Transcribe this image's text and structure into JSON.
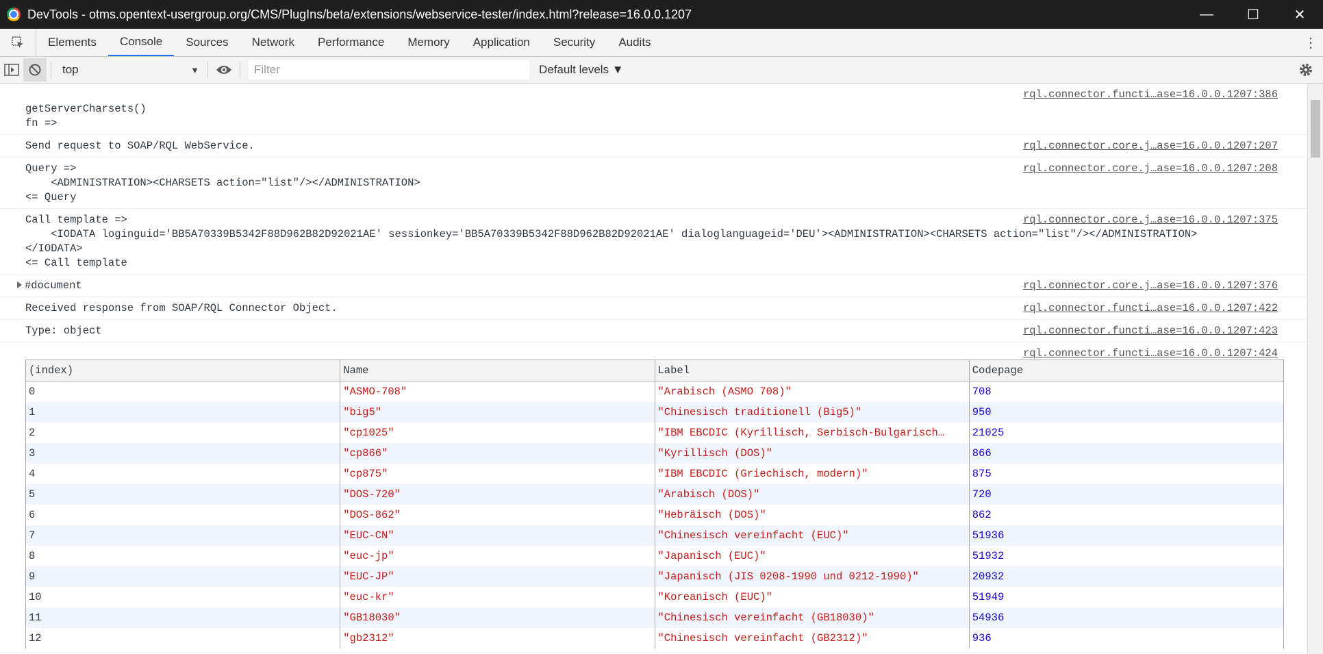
{
  "window": {
    "title": "DevTools - otms.opentext-usergroup.org/CMS/PlugIns/beta/extensions/webservice-tester/index.html?release=16.0.0.1207",
    "minimize": "—",
    "maximize": "☐",
    "close": "✕"
  },
  "tabs": [
    "Elements",
    "Console",
    "Sources",
    "Network",
    "Performance",
    "Memory",
    "Application",
    "Security",
    "Audits"
  ],
  "toolbar": {
    "context": "top",
    "filter_placeholder": "Filter",
    "levels": "Default levels ▼"
  },
  "messages": [
    {
      "text": "\ngetServerCharsets()\nfn =>",
      "source": "rql.connector.functi…ase=16.0.0.1207:386"
    },
    {
      "text": "Send request to SOAP/RQL WebService.",
      "source": "rql.connector.core.j…ase=16.0.0.1207:207"
    },
    {
      "text": "Query =>\n    <ADMINISTRATION><CHARSETS action=\"list\"/></ADMINISTRATION>\n<= Query",
      "source": "rql.connector.core.j…ase=16.0.0.1207:208"
    },
    {
      "text": "Call template =>\n    <IODATA loginguid='BB5A70339B5342F88D962B82D92021AE' sessionkey='BB5A70339B5342F88D962B82D92021AE' dialoglanguageid='DEU'><ADMINISTRATION><CHARSETS action=\"list\"/></ADMINISTRATION>\n</IODATA>\n<= Call template",
      "source": "rql.connector.core.j…ase=16.0.0.1207:375"
    },
    {
      "text": "#document",
      "source": "rql.connector.core.j…ase=16.0.0.1207:376",
      "expandable": true
    },
    {
      "text": "Received response from SOAP/RQL Connector Object.",
      "source": "rql.connector.functi…ase=16.0.0.1207:422"
    },
    {
      "text": "Type: object",
      "source": "rql.connector.functi…ase=16.0.0.1207:423"
    }
  ],
  "table_source": "rql.connector.functi…ase=16.0.0.1207:424",
  "table": {
    "headers": [
      "(index)",
      "Name",
      "Label",
      "Codepage"
    ],
    "rows": [
      [
        "0",
        "\"ASMO-708\"",
        "\"Arabisch (ASMO 708)\"",
        "708"
      ],
      [
        "1",
        "\"big5\"",
        "\"Chinesisch traditionell (Big5)\"",
        "950"
      ],
      [
        "2",
        "\"cp1025\"",
        "\"IBM EBCDIC (Kyrillisch, Serbisch-Bulgarisch…",
        "21025"
      ],
      [
        "3",
        "\"cp866\"",
        "\"Kyrillisch (DOS)\"",
        "866"
      ],
      [
        "4",
        "\"cp875\"",
        "\"IBM EBCDIC (Griechisch, modern)\"",
        "875"
      ],
      [
        "5",
        "\"DOS-720\"",
        "\"Arabisch (DOS)\"",
        "720"
      ],
      [
        "6",
        "\"DOS-862\"",
        "\"Hebräisch (DOS)\"",
        "862"
      ],
      [
        "7",
        "\"EUC-CN\"",
        "\"Chinesisch vereinfacht (EUC)\"",
        "51936"
      ],
      [
        "8",
        "\"euc-jp\"",
        "\"Japanisch (EUC)\"",
        "51932"
      ],
      [
        "9",
        "\"EUC-JP\"",
        "\"Japanisch (JIS 0208-1990 und 0212-1990)\"",
        "20932"
      ],
      [
        "10",
        "\"euc-kr\"",
        "\"Koreanisch (EUC)\"",
        "51949"
      ],
      [
        "11",
        "\"GB18030\"",
        "\"Chinesisch vereinfacht (GB18030)\"",
        "54936"
      ],
      [
        "12",
        "\"gb2312\"",
        "\"Chinesisch vereinfacht (GB2312)\"",
        "936"
      ]
    ]
  },
  "colors": {
    "string": "#c41a16",
    "number": "#1c00cf",
    "active_tab": "#1a73e8"
  }
}
